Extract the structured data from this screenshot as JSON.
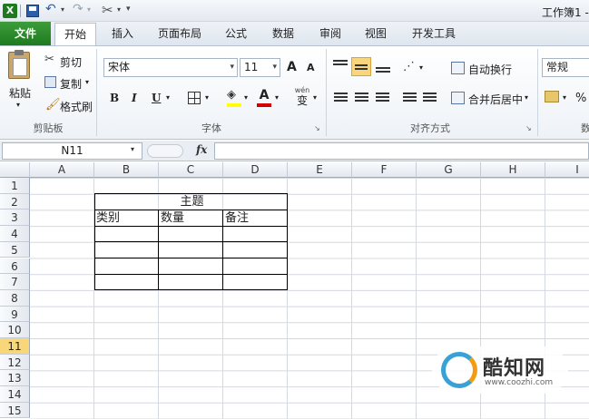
{
  "title_bar": {
    "title": "工作簿1 -"
  },
  "tabs": {
    "file": "文件",
    "home": "开始",
    "insert": "插入",
    "page_layout": "页面布局",
    "formulas": "公式",
    "data": "数据",
    "review": "审阅",
    "view": "视图",
    "developer": "开发工具"
  },
  "clipboard": {
    "paste": "粘贴",
    "cut": "剪切",
    "copy": "复制",
    "format_painter": "格式刷",
    "group": "剪贴板"
  },
  "font": {
    "name": "宋体",
    "size": "11",
    "grow": "A",
    "shrink": "A",
    "bold": "B",
    "italic": "I",
    "underline": "U",
    "font_color_glyph": "A",
    "phonetic": "wén",
    "group": "字体"
  },
  "alignment": {
    "wrap": "自动换行",
    "merge": "合并后居中",
    "group": "对齐方式"
  },
  "number": {
    "format": "常规",
    "percent": "%",
    "group_partial": "数"
  },
  "formula_bar": {
    "name_box": "N11",
    "fx": "fx",
    "value": ""
  },
  "columns": [
    "A",
    "B",
    "C",
    "D",
    "E",
    "F",
    "G",
    "H",
    "I"
  ],
  "rows": [
    "1",
    "2",
    "3",
    "4",
    "5",
    "6",
    "7",
    "8",
    "9",
    "10",
    "11",
    "12",
    "13",
    "14",
    "15"
  ],
  "selected_row": "11",
  "table": {
    "title": "主题",
    "headers": [
      "类别",
      "数量",
      "备注"
    ]
  },
  "watermark": {
    "brand": "酷知网",
    "url": "www.coozhi.com"
  },
  "colors": {
    "excel_green": "#1f7a1f",
    "ribbon_bg": "#eef2f7",
    "selected_header": "#f8d77b",
    "underline_red": "#d00000",
    "highlight_yellow": "#ffff00"
  }
}
